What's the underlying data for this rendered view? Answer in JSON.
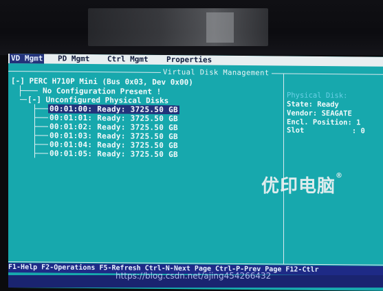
{
  "menu": {
    "tabs": [
      "VD Mgmt",
      "PD Mgmt",
      "Ctrl Mgmt",
      "Properties"
    ],
    "active": "VD Mgmt"
  },
  "panel_title": "Virtual Disk Management",
  "tree": {
    "controller": "[-] PERC H710P Mini (Bus 0x03, Dev 0x00)",
    "no_config": "No Configuration Present !",
    "unconfigured": "[-] Unconfigured Physical Disks"
  },
  "disks": [
    "00:01:00: Ready: 3725.50 GB",
    "00:01:01: Ready: 3725.50 GB",
    "00:01:02: Ready: 3725.50 GB",
    "00:01:03: Ready: 3725.50 GB",
    "00:01:04: Ready: 3725.50 GB",
    "00:01:05: Ready: 3725.50 GB"
  ],
  "side_panel": {
    "title": "Physical Disk:",
    "state": "State: Ready",
    "vendor": "Vendor: SEAGATE",
    "encl": "Encl. Position: 1",
    "slot": "Slot           : 0"
  },
  "status_bar": "F1-Help F2-Operations F5-Refresh Ctrl-N-Next Page Ctrl-P-Prev Page F12-Ctlr",
  "watermark": {
    "text": "优印电脑",
    "mark": "®"
  },
  "url": "https://blog.csdn.net/ajing454266432"
}
